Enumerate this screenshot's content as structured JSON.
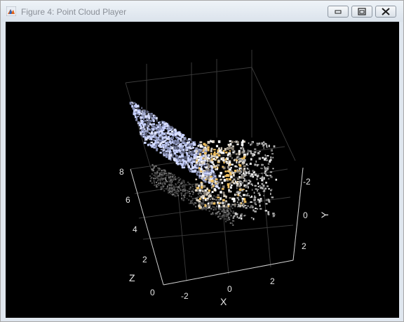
{
  "window": {
    "title": "Figure 4: Point Cloud Player",
    "icon": "matlab-icon",
    "controls": [
      "minimize-icon",
      "maximize-icon",
      "close-icon"
    ]
  },
  "chart_data": {
    "type": "scatter",
    "dimensions": 3,
    "xlabel": "X",
    "ylabel": "Y",
    "zlabel": "Z",
    "x_ticks": [
      "-2",
      "0",
      "2"
    ],
    "y_ticks": [
      "-2",
      "0",
      "2"
    ],
    "z_ticks": [
      "0",
      "2",
      "4",
      "6",
      "8"
    ],
    "xlim": [
      -3,
      3
    ],
    "ylim": [
      -3,
      3
    ],
    "zlim": [
      0,
      8
    ],
    "grid": true,
    "background": "#000000",
    "colors": {
      "axis": "#e6e6e6",
      "grid": "#3a3a3a",
      "points_light": "#c8d2ff",
      "points_warm": "#f0c060",
      "points_gray": "#b0b0b0"
    }
  }
}
